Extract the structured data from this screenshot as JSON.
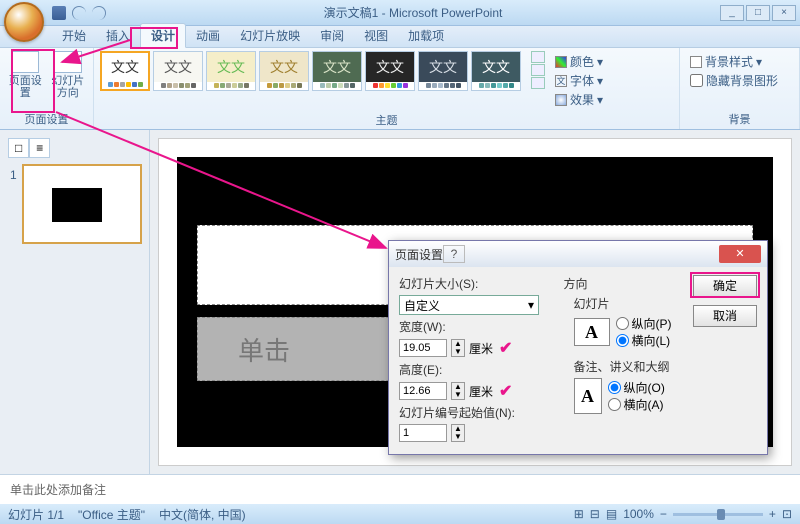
{
  "window": {
    "title": "演示文稿1 - Microsoft PowerPoint"
  },
  "tabs": [
    "开始",
    "插入",
    "设计",
    "动画",
    "幻灯片放映",
    "审阅",
    "视图",
    "加载项"
  ],
  "active_tab": 2,
  "ribbon": {
    "page_setup": {
      "btn1": "页面设置",
      "btn2": "幻灯片\n方向",
      "label": "页面设置"
    },
    "themes": {
      "label": "主题",
      "items": [
        {
          "tx": "文文",
          "bg": "#ffffff",
          "fg": "#333",
          "dots": [
            "#5b9bd5",
            "#ed7d31",
            "#a5a5a5",
            "#ffc000",
            "#4472c4",
            "#70ad47"
          ]
        },
        {
          "tx": "文文",
          "bg": "#f7f7f2",
          "fg": "#555",
          "dots": [
            "#7f7f7f",
            "#b0a28a",
            "#c9bfa9",
            "#8a8f6f",
            "#a3a37a",
            "#666"
          ]
        },
        {
          "tx": "文文",
          "bg": "#f5eec9",
          "fg": "#6b5",
          "dots": [
            "#c5b358",
            "#8a7",
            "#aa9",
            "#cc9",
            "#9a8",
            "#776"
          ]
        },
        {
          "tx": "文文",
          "bg": "#efe6c9",
          "fg": "#a08030",
          "dots": [
            "#c49a3a",
            "#8a6",
            "#b94",
            "#dc8",
            "#aa7",
            "#775"
          ]
        },
        {
          "tx": "文文",
          "bg": "#4f6b52",
          "fg": "#d9e3c7",
          "dots": [
            "#9bb",
            "#bca",
            "#7a8",
            "#cdb",
            "#899",
            "#566"
          ]
        },
        {
          "tx": "文文",
          "bg": "#262626",
          "fg": "#eee",
          "dots": [
            "#e33",
            "#f93",
            "#fd3",
            "#6c3",
            "#39d",
            "#93d"
          ]
        },
        {
          "tx": "文文",
          "bg": "#3a4a5a",
          "fg": "#d8dee6",
          "dots": [
            "#789",
            "#9ab",
            "#abc",
            "#678",
            "#567",
            "#456"
          ]
        },
        {
          "tx": "文文",
          "bg": "#3e5a62",
          "fg": "#fff",
          "dots": [
            "#6aa",
            "#8bb",
            "#499",
            "#7cc",
            "#5aa",
            "#388"
          ]
        }
      ],
      "side": {
        "colors": "颜色",
        "fonts": "字体",
        "effects": "效果"
      }
    },
    "background": {
      "label": "背景",
      "style": "背景样式",
      "hide": "隐藏背景图形"
    }
  },
  "slide": {
    "title": "单击",
    "subtitle": "单击"
  },
  "notes_placeholder": "单击此处添加备注",
  "dialog": {
    "title": "页面设置",
    "size_label": "幻灯片大小(S):",
    "size_value": "自定义",
    "width_label": "宽度(W):",
    "width_value": "19.05",
    "unit": "厘米",
    "height_label": "高度(E):",
    "height_value": "12.66",
    "start_label": "幻灯片编号起始值(N):",
    "start_value": "1",
    "orient_label": "方向",
    "slides_label": "幻灯片",
    "portrait": "纵向(P)",
    "landscape": "横向(L)",
    "notes_label": "备注、讲义和大纲",
    "portrait2": "纵向(O)",
    "landscape2": "横向(A)",
    "ok": "确定",
    "cancel": "取消"
  },
  "status": {
    "slide": "幻灯片 1/1",
    "theme": "\"Office 主题\"",
    "lang": "中文(简体, 中国)",
    "zoom": "100%"
  }
}
